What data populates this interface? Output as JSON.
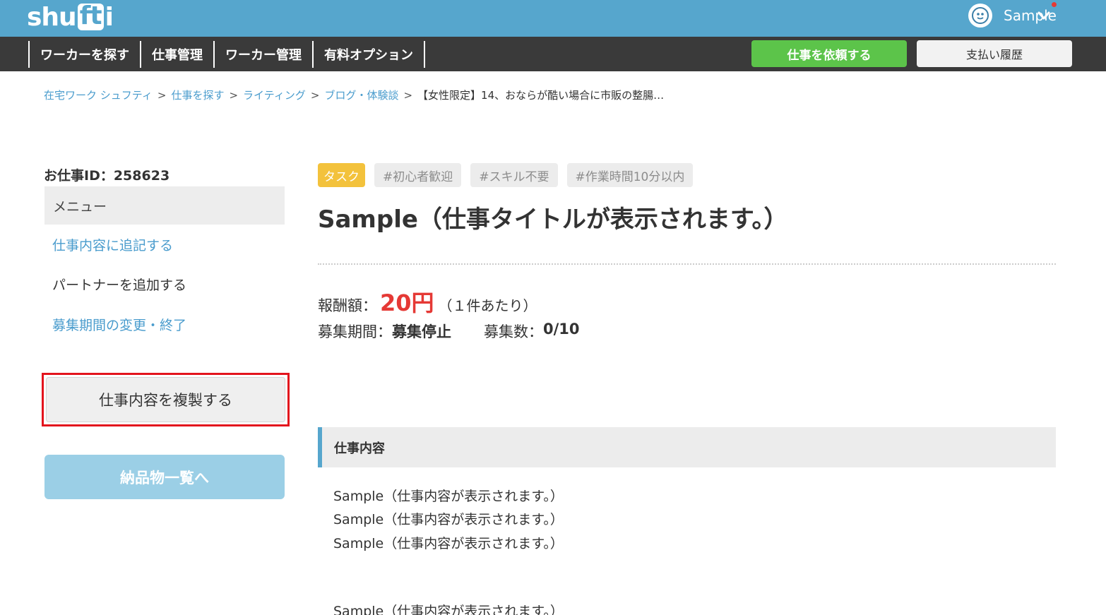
{
  "header": {
    "logo_pre": "shu",
    "logo_ft": "ft",
    "logo_post": "i",
    "user_name": "Sample"
  },
  "nav": {
    "items": [
      "ワーカーを探す",
      "仕事管理",
      "ワーカー管理",
      "有料オプション"
    ],
    "request_button": "仕事を依頼する",
    "payment_button": "支払い履歴"
  },
  "breadcrumb": {
    "items": [
      "在宅ワーク シュフティ",
      "仕事を探す",
      "ライティング",
      "ブログ・体験談"
    ],
    "separator": ">",
    "current": "【女性限定】14、おならが酷い場合に市販の整腸…"
  },
  "sidebar": {
    "job_id": "お仕事ID：258623",
    "menu_label": "メニュー",
    "links": [
      "仕事内容に追記する",
      "パートナーを追加する",
      "募集期間の変更・終了"
    ],
    "duplicate_button": "仕事内容を複製する",
    "deliverables_button": "納品物一覧へ"
  },
  "main": {
    "tags": [
      "タスク",
      "#初心者歓迎",
      "#スキル不要",
      "#作業時間10分以内"
    ],
    "title": "Sample（仕事タイトルが表示されます。）",
    "reward_label": "報酬額：",
    "reward_amount": "20円",
    "reward_unit": "（１件あたり）",
    "period_label": "募集期間：",
    "period_value": "募集停止",
    "count_label": "募集数：",
    "count_value": "0/10",
    "section_title": "仕事内容",
    "content_lines": [
      "Sample（仕事内容が表示されます。）",
      "Sample（仕事内容が表示されます。）",
      "Sample（仕事内容が表示されます。）",
      "Sample（仕事内容が表示されます。）"
    ]
  },
  "colors": {
    "header_blue": "#56a6cd",
    "nav_dark": "#3a3a3a",
    "accent_green": "#5cc44a",
    "price_red": "#e53935",
    "highlight_red": "#e3141d",
    "tag_yellow": "#f3c23c"
  },
  "icons": {
    "avatar": "user-avatar-icon",
    "dropdown": "chevron-down-icon",
    "notification": "notification-dot-icon"
  }
}
